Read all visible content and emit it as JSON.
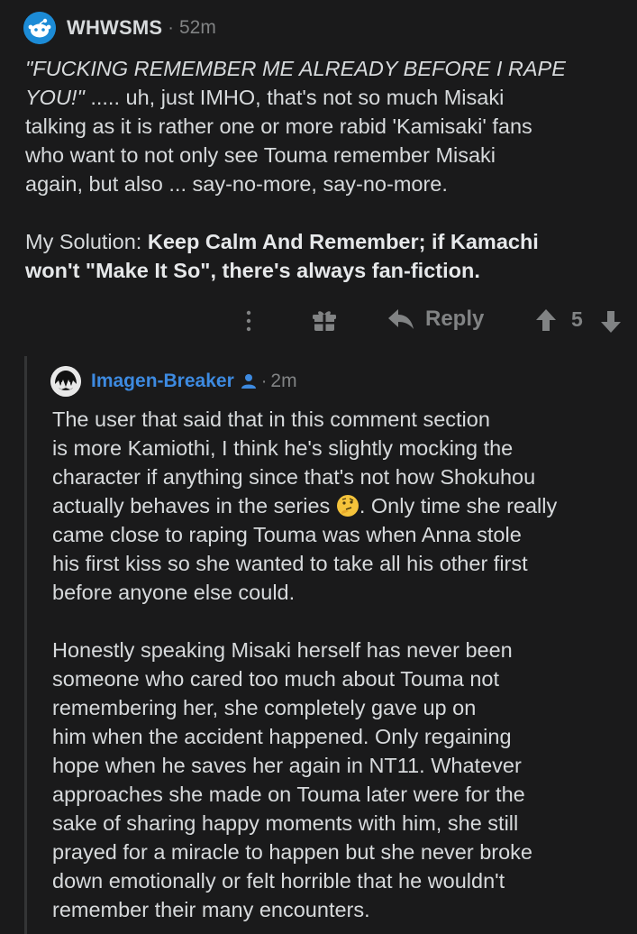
{
  "comment": {
    "username": "WHWSMS",
    "separator": "·",
    "time": "52m",
    "body": {
      "line1_italic": "\"FUCKING REMEMBER ME ALREADY BEFORE I RAPE",
      "line2_italic": "YOU!\"",
      "line2_rest": " ..... uh, just IMHO, that's not so much Misaki",
      "line3": "talking as it is rather one or more rabid 'Kamisaki' fans",
      "line4": "who want to not only see Touma remember Misaki",
      "line5": "again, but also  ... say-no-more, say-no-more.",
      "solution_prefix": "My Solution: ",
      "solution_bold_1": "Keep Calm And Remember; if Kamachi",
      "solution_bold_2": "won't \"Make It So\", there's always fan-fiction."
    },
    "actions": {
      "more_icon": "more-vertical-icon",
      "award_icon": "gift-award-icon",
      "reply_icon": "reply-arrow-icon",
      "reply_label": "Reply",
      "upvote_icon": "upvote-arrow-icon",
      "score": "5",
      "downvote_icon": "downvote-arrow-icon"
    }
  },
  "reply": {
    "username": "Imagen-Breaker",
    "op_icon": "user-op-icon",
    "separator": "·",
    "time": "2m",
    "body": {
      "p1_l1": "The user that said that in this comment section",
      "p1_l2": "is more Kamiothi, I think he's slightly mocking the",
      "p1_l3": "character if anything since that's not how Shokuhou",
      "p1_l4_a": "actually behaves in the series ",
      "p1_l4_emoji": "thinking-face-emoji",
      "p1_l4_b": ". Only time she really",
      "p1_l5": "came close to raping Touma was when Anna stole",
      "p1_l6": "his first kiss so she wanted to take all his other first",
      "p1_l7": "before anyone else could.",
      "p2_l1": "Honestly speaking Misaki herself has never been",
      "p2_l2": "someone who cared too much about Touma not",
      "p2_l3": "remembering her, she completely gave up on",
      "p2_l4": "him when the accident happened. Only regaining",
      "p2_l5": "hope when he saves her again in NT11. Whatever",
      "p2_l6": "approaches she made on Touma later were for the",
      "p2_l7": "sake of sharing happy moments with him, she still",
      "p2_l8": "prayed for a miracle to happen but she never broke",
      "p2_l9": "down emotionally or felt horrible that he wouldn't",
      "p2_l10": "remember their many encounters."
    }
  },
  "colors": {
    "background": "#1a1a1b",
    "text": "#d7dadc",
    "muted": "#818384",
    "link_username": "#3d8ae0",
    "avatar_blue": "#1c8bd6"
  }
}
